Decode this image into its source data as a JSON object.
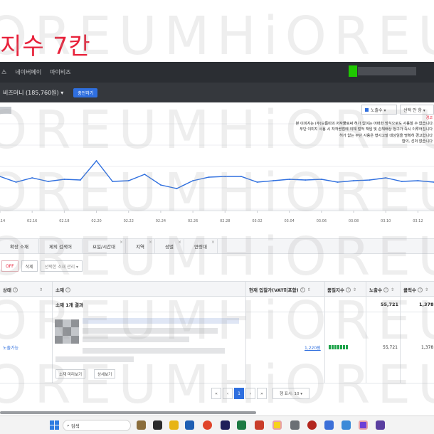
{
  "heading": "지수 7칸",
  "topbar": {
    "nav": [
      "스",
      "네이버페이",
      "마이비즈"
    ]
  },
  "subbar": {
    "biz_money": "비즈머니 (185,760원) ▾",
    "charge_button": "충전하기"
  },
  "chart_controls": {
    "metric_select": "노출수 ▾",
    "compare_select": "선택 안 함 ▾"
  },
  "notice": {
    "title": "경고",
    "lines": [
      "본 이미지는 (주)오름미의 저작물로써 허가 없이는 어떠한 방식으로도 사용할 수 없습니다",
      "무단 이미지 사용 시 저작권법에 의해 벌적 책임 및 손해배상 청구가 즉시 이루어집니다",
      "허가 없는 무단 사용은 형사고발 대상임을 명확히 경고합니다",
      "합의, 선처 없습니다"
    ]
  },
  "chart_data": {
    "type": "line",
    "x": [
      "02.14",
      "02.15",
      "02.16",
      "02.17",
      "02.18",
      "02.19",
      "02.20",
      "02.21",
      "02.22",
      "02.23",
      "02.24",
      "02.25",
      "02.26",
      "02.27",
      "02.28",
      "03.01",
      "03.02",
      "03.03",
      "03.04",
      "03.05",
      "03.06",
      "03.07",
      "03.08",
      "03.09",
      "03.10",
      "03.11",
      "03.12",
      "03.13"
    ],
    "tick_labels": [
      "02.14",
      "02.16",
      "02.18",
      "02.20",
      "02.22",
      "02.24",
      "02.26",
      "02.28",
      "03.02",
      "03.04",
      "03.06",
      "03.08",
      "03.10",
      "03.12"
    ],
    "series": [
      {
        "values": [
          2300,
          1900,
          2200,
          1950,
          2100,
          2050,
          3400,
          1950,
          2000,
          2450,
          1700,
          1450,
          2000,
          2250,
          2300,
          2300,
          1900,
          2000,
          2100,
          2050,
          2100,
          1900,
          2000,
          2050,
          2200,
          1950,
          2000,
          1900
        ],
        "color": "#2f6fdf"
      }
    ],
    "ylim": [
      0,
      6000
    ],
    "grid": true
  },
  "tabs": [
    {
      "label": "확장 소재",
      "closable": false
    },
    {
      "label": "제외 검색어",
      "closable": false
    },
    {
      "label": "요일/시간대",
      "closable": true
    },
    {
      "label": "지역",
      "closable": true
    },
    {
      "label": "성별",
      "closable": true
    },
    {
      "label": "연령대",
      "closable": true
    }
  ],
  "toolbar": {
    "off_button": "OFF",
    "delete_button": "삭제",
    "manage_dropdown": "선택한 소재 관리 ▾"
  },
  "table": {
    "headers": {
      "status": "상태",
      "creative": "소재",
      "bid": "현재 입찰가(VAT미포함)",
      "quality": "품질지수",
      "impressions": "노출수",
      "clicks": "클릭수"
    },
    "summary": {
      "label": "소재 1개 결과",
      "impressions": "55,721",
      "clicks": "1,378"
    },
    "row": {
      "status": "노출가능",
      "bid": "1,220원",
      "quality_bars": 7,
      "impressions": "55,721",
      "clicks": "1,378",
      "preview_button": "소재 미리보기",
      "detail_button": "상세보기"
    }
  },
  "pager": {
    "first": "«",
    "prev": "‹",
    "current": "1",
    "next": "›",
    "last": "»",
    "per_page": "행 표시: 10 ▾"
  },
  "taskbar": {
    "search_placeholder": "검색"
  },
  "watermark": "OREUMHiOREU"
}
